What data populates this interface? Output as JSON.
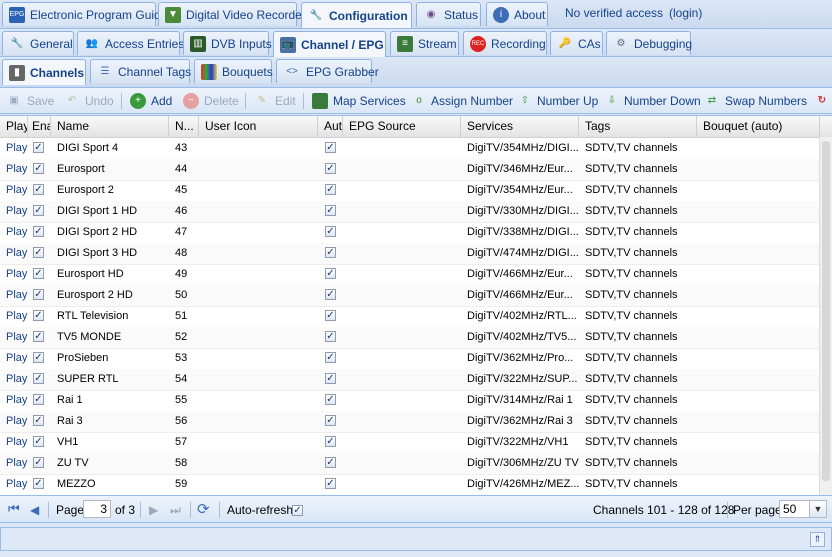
{
  "top_tabs": [
    {
      "label": "Electronic Program Guide",
      "icon": "epg-icon"
    },
    {
      "label": "Digital Video Recorder",
      "icon": "dvr-icon"
    },
    {
      "label": "Configuration",
      "icon": "wrench-icon"
    },
    {
      "label": "Status",
      "icon": "eye-icon"
    },
    {
      "label": "About",
      "icon": "info-icon"
    }
  ],
  "access_status": "No verified access",
  "login_link": "(login)",
  "config_tabs": [
    {
      "label": "General"
    },
    {
      "label": "Access Entries"
    },
    {
      "label": "DVB Inputs"
    },
    {
      "label": "Channel / EPG"
    },
    {
      "label": "Stream"
    },
    {
      "label": "Recording"
    },
    {
      "label": "CAs"
    },
    {
      "label": "Debugging"
    }
  ],
  "sub_tabs": [
    {
      "label": "Channels"
    },
    {
      "label": "Channel Tags"
    },
    {
      "label": "Bouquets"
    },
    {
      "label": "EPG Grabber"
    }
  ],
  "toolbar": {
    "save": "Save",
    "undo": "Undo",
    "add": "Add",
    "delete": "Delete",
    "edit": "Edit",
    "map_services": "Map Services",
    "assign_number": "Assign Number",
    "number_up": "Number Up",
    "number_down": "Number Down",
    "swap_numbers": "Swap Numbers"
  },
  "columns": [
    "Play",
    "Ena",
    "Name",
    "N...",
    "User Icon",
    "Aut",
    "EPG Source",
    "Services",
    "Tags",
    "Bouquet (auto)"
  ],
  "rows": [
    {
      "play": "Play",
      "name": "DIGI Sport 4",
      "number": "43",
      "services": "DigiTV/354MHz/DIGI...",
      "tags": "SDTV,TV channels"
    },
    {
      "play": "Play",
      "name": "Eurosport",
      "number": "44",
      "services": "DigiTV/346MHz/Eur...",
      "tags": "SDTV,TV channels"
    },
    {
      "play": "Play",
      "name": "Eurosport 2",
      "number": "45",
      "services": "DigiTV/354MHz/Eur...",
      "tags": "SDTV,TV channels"
    },
    {
      "play": "Play",
      "name": "DIGI Sport 1 HD",
      "number": "46",
      "services": "DigiTV/330MHz/DIGI...",
      "tags": "SDTV,TV channels"
    },
    {
      "play": "Play",
      "name": "DIGI Sport 2 HD",
      "number": "47",
      "services": "DigiTV/338MHz/DIGI...",
      "tags": "SDTV,TV channels"
    },
    {
      "play": "Play",
      "name": "DIGI Sport 3 HD",
      "number": "48",
      "services": "DigiTV/474MHz/DIGI...",
      "tags": "SDTV,TV channels"
    },
    {
      "play": "Play",
      "name": "Eurosport HD",
      "number": "49",
      "services": "DigiTV/466MHz/Eur...",
      "tags": "SDTV,TV channels"
    },
    {
      "play": "Play",
      "name": "Eurosport 2 HD",
      "number": "50",
      "services": "DigiTV/466MHz/Eur...",
      "tags": "SDTV,TV channels"
    },
    {
      "play": "Play",
      "name": "RTL Television",
      "number": "51",
      "services": "DigiTV/402MHz/RTL...",
      "tags": "SDTV,TV channels"
    },
    {
      "play": "Play",
      "name": "TV5 MONDE",
      "number": "52",
      "services": "DigiTV/402MHz/TV5...",
      "tags": "SDTV,TV channels"
    },
    {
      "play": "Play",
      "name": "ProSieben",
      "number": "53",
      "services": "DigiTV/362MHz/Pro...",
      "tags": "SDTV,TV channels"
    },
    {
      "play": "Play",
      "name": "SUPER RTL",
      "number": "54",
      "services": "DigiTV/322MHz/SUP...",
      "tags": "SDTV,TV channels"
    },
    {
      "play": "Play",
      "name": "Rai 1",
      "number": "55",
      "services": "DigiTV/314MHz/Rai 1",
      "tags": "SDTV,TV channels"
    },
    {
      "play": "Play",
      "name": "Rai 3",
      "number": "56",
      "services": "DigiTV/362MHz/Rai 3",
      "tags": "SDTV,TV channels"
    },
    {
      "play": "Play",
      "name": "VH1",
      "number": "57",
      "services": "DigiTV/322MHz/VH1",
      "tags": "SDTV,TV channels"
    },
    {
      "play": "Play",
      "name": "ZU TV",
      "number": "58",
      "services": "DigiTV/306MHz/ZU TV",
      "tags": "SDTV,TV channels"
    },
    {
      "play": "Play",
      "name": "MEZZO",
      "number": "59",
      "services": "DigiTV/426MHz/MEZ...",
      "tags": "SDTV,TV channels"
    }
  ],
  "pager": {
    "page_label": "Page",
    "page_value": "3",
    "of_label": "of 3",
    "auto_refresh": "Auto-refresh",
    "summary": "Channels 101 - 128 of 128",
    "per_page_label": "Per page",
    "per_page_value": "50"
  }
}
